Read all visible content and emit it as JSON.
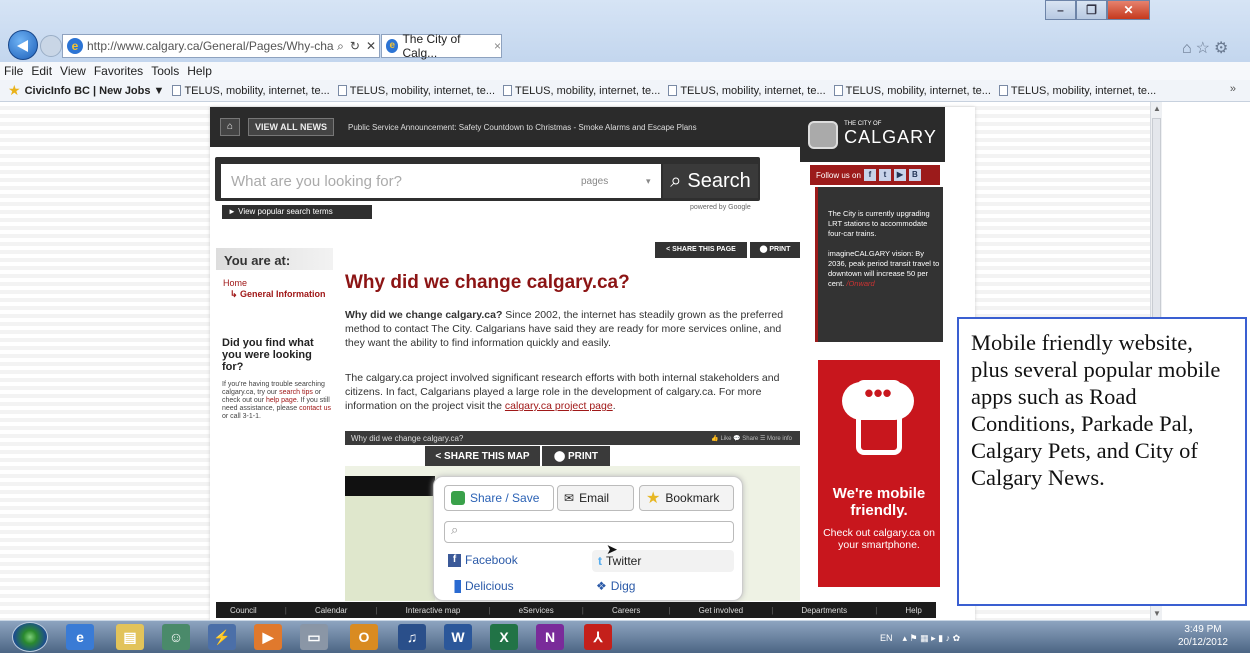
{
  "browser": {
    "url": "http://www.calgary.ca/General/Pages/Why-chang",
    "tab_title": "The City of Calg...",
    "tab_close": "×",
    "window_buttons": {
      "minimize": "–",
      "maximize": "❐",
      "close": "✕"
    },
    "menu": [
      "File",
      "Edit",
      "View",
      "Favorites",
      "Tools",
      "Help"
    ],
    "favorites": [
      "CivicInfo BC | New Jobs ▼",
      "TELUS, mobility, internet, te...",
      "TELUS, mobility, internet, te...",
      "TELUS, mobility, internet, te...",
      "TELUS, mobility, internet, te...",
      "TELUS, mobility, internet, te...",
      "TELUS, mobility, internet, te..."
    ],
    "favorites_more": "»"
  },
  "site": {
    "nav": {
      "view_all": "VIEW ALL NEWS",
      "psa": "Public Service Announcement: Safety Countdown to Christmas - Smoke Alarms and Escape Plans"
    },
    "logo": {
      "small": "THE CITY OF",
      "big": "CALGARY"
    },
    "follow": "Follow us on",
    "search": {
      "placeholder": "What are you looking for?",
      "scope": "pages",
      "button": "Search",
      "popular": "► View popular search terms",
      "powered": "powered by Google"
    },
    "share_page": "< SHARE THIS PAGE",
    "print": "⬤ PRINT",
    "you_are_at": "You are at:",
    "breadcrumb": {
      "home": "Home",
      "current": "↳ General Information"
    },
    "help": {
      "title": "Did you find what you were looking for?",
      "t1": "If you're having trouble searching calgary.ca, try our ",
      "l1": "search tips",
      "t2": " or check out our ",
      "l2": "help page",
      "t3": ". If you still need assistance, please ",
      "l3": "contact us",
      "t4": " or call 3-1-1."
    },
    "headline": "Why did we change calgary.ca?",
    "para1_bold": "Why did we change calgary.ca?",
    "para1": " Since 2002, the internet has steadily grown as the preferred method to contact The City. Calgarians have said they are ready for more services online, and they want the ability to find information quickly and easily.",
    "para2": "The calgary.ca project involved significant research efforts with both internal stakeholders and citizens. In fact, Calgarians played a large role in the development of calgary.ca. For more information on the project visit the ",
    "para2_link": "calgary.ca project page",
    "para2_end": ".",
    "video_title": "Why did we change calgary.ca?",
    "video_actions": "👍 Like   💬   Share   ☰ More info",
    "share_map": "< SHARE THIS MAP",
    "print_map": "⬤ PRINT",
    "sharebox": {
      "share": "Share / Save",
      "email": "Email",
      "bookmark": "Bookmark",
      "facebook": "Facebook",
      "twitter": "Twitter",
      "delicious": "Delicious",
      "digg": "Digg"
    },
    "sidebar_note": "The City is currently upgrading LRT stations to accommodate four-car trains.",
    "sidebar_note2": "imagineCALGARY vision: By 2036, peak period transit travel to downtown will increase 50 per cent.",
    "sidebar_link": "/Onward",
    "ad": {
      "title": "We're mobile friendly.",
      "sub": "Check out calgary.ca on your smartphone."
    },
    "footer": [
      "Council",
      "Calendar",
      "Interactive map",
      "eServices",
      "Careers",
      "Get involved",
      "Departments",
      "Help"
    ]
  },
  "callout": "Mobile friendly website, plus several popular mobile apps such as Road Conditions, Parkade Pal, Calgary Pets, and City of Calgary News.",
  "taskbar": {
    "lang": "EN",
    "time": "3:49 PM",
    "date": "20/12/2012"
  }
}
